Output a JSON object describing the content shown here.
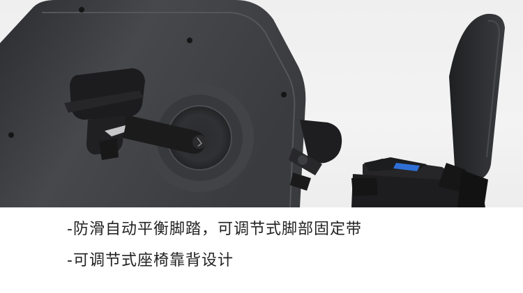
{
  "features": [
    "-防滑自动平衡脚踏，可调节式脚部固定带",
    "-可调节式座椅靠背设计"
  ],
  "colors": {
    "background": "#ffffff",
    "photo_background": "#f0f0f0",
    "housing": "#3c3d40",
    "pedal": "#232325",
    "accent_blue": "#2f6fd6",
    "text": "#222222"
  }
}
